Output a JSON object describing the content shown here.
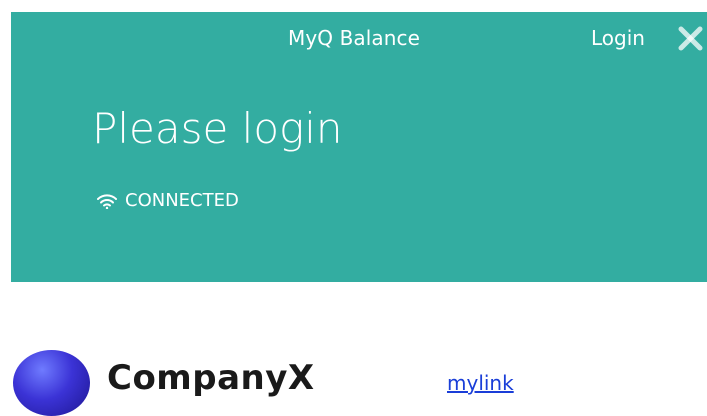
{
  "header": {
    "app_title": "MyQ Balance",
    "login_label": "Login",
    "heading": "Please login",
    "status": "CONNECTED",
    "background_color": "#33ADA1",
    "icons": {
      "close": "close-icon",
      "status": "wifi-icon"
    }
  },
  "footer": {
    "logo_text": "CompanyX",
    "link_text": "mylink",
    "link_color": "#1a3ed8"
  }
}
